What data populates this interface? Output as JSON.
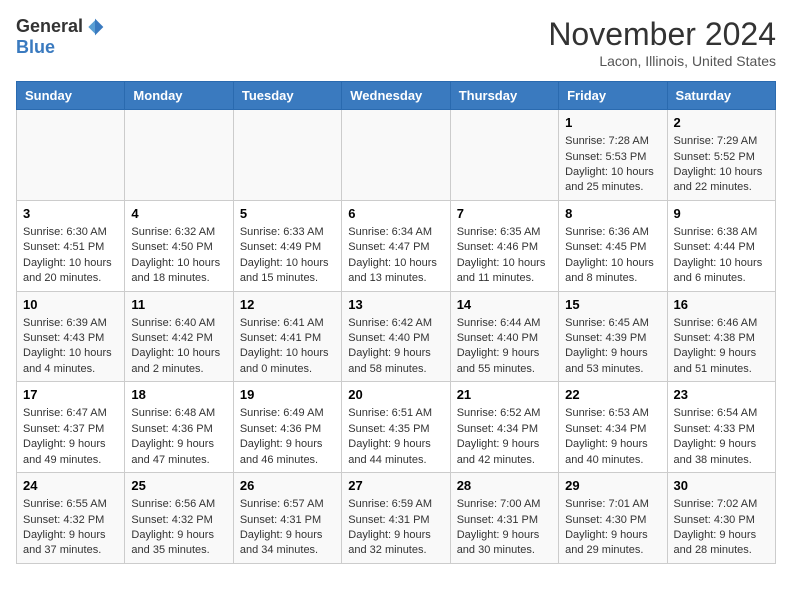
{
  "header": {
    "logo_general": "General",
    "logo_blue": "Blue",
    "month_title": "November 2024",
    "location": "Lacon, Illinois, United States"
  },
  "weekdays": [
    "Sunday",
    "Monday",
    "Tuesday",
    "Wednesday",
    "Thursday",
    "Friday",
    "Saturday"
  ],
  "weeks": [
    [
      {
        "day": "",
        "info": ""
      },
      {
        "day": "",
        "info": ""
      },
      {
        "day": "",
        "info": ""
      },
      {
        "day": "",
        "info": ""
      },
      {
        "day": "",
        "info": ""
      },
      {
        "day": "1",
        "info": "Sunrise: 7:28 AM\nSunset: 5:53 PM\nDaylight: 10 hours\nand 25 minutes."
      },
      {
        "day": "2",
        "info": "Sunrise: 7:29 AM\nSunset: 5:52 PM\nDaylight: 10 hours\nand 22 minutes."
      }
    ],
    [
      {
        "day": "3",
        "info": "Sunrise: 6:30 AM\nSunset: 4:51 PM\nDaylight: 10 hours\nand 20 minutes."
      },
      {
        "day": "4",
        "info": "Sunrise: 6:32 AM\nSunset: 4:50 PM\nDaylight: 10 hours\nand 18 minutes."
      },
      {
        "day": "5",
        "info": "Sunrise: 6:33 AM\nSunset: 4:49 PM\nDaylight: 10 hours\nand 15 minutes."
      },
      {
        "day": "6",
        "info": "Sunrise: 6:34 AM\nSunset: 4:47 PM\nDaylight: 10 hours\nand 13 minutes."
      },
      {
        "day": "7",
        "info": "Sunrise: 6:35 AM\nSunset: 4:46 PM\nDaylight: 10 hours\nand 11 minutes."
      },
      {
        "day": "8",
        "info": "Sunrise: 6:36 AM\nSunset: 4:45 PM\nDaylight: 10 hours\nand 8 minutes."
      },
      {
        "day": "9",
        "info": "Sunrise: 6:38 AM\nSunset: 4:44 PM\nDaylight: 10 hours\nand 6 minutes."
      }
    ],
    [
      {
        "day": "10",
        "info": "Sunrise: 6:39 AM\nSunset: 4:43 PM\nDaylight: 10 hours\nand 4 minutes."
      },
      {
        "day": "11",
        "info": "Sunrise: 6:40 AM\nSunset: 4:42 PM\nDaylight: 10 hours\nand 2 minutes."
      },
      {
        "day": "12",
        "info": "Sunrise: 6:41 AM\nSunset: 4:41 PM\nDaylight: 10 hours\nand 0 minutes."
      },
      {
        "day": "13",
        "info": "Sunrise: 6:42 AM\nSunset: 4:40 PM\nDaylight: 9 hours\nand 58 minutes."
      },
      {
        "day": "14",
        "info": "Sunrise: 6:44 AM\nSunset: 4:40 PM\nDaylight: 9 hours\nand 55 minutes."
      },
      {
        "day": "15",
        "info": "Sunrise: 6:45 AM\nSunset: 4:39 PM\nDaylight: 9 hours\nand 53 minutes."
      },
      {
        "day": "16",
        "info": "Sunrise: 6:46 AM\nSunset: 4:38 PM\nDaylight: 9 hours\nand 51 minutes."
      }
    ],
    [
      {
        "day": "17",
        "info": "Sunrise: 6:47 AM\nSunset: 4:37 PM\nDaylight: 9 hours\nand 49 minutes."
      },
      {
        "day": "18",
        "info": "Sunrise: 6:48 AM\nSunset: 4:36 PM\nDaylight: 9 hours\nand 47 minutes."
      },
      {
        "day": "19",
        "info": "Sunrise: 6:49 AM\nSunset: 4:36 PM\nDaylight: 9 hours\nand 46 minutes."
      },
      {
        "day": "20",
        "info": "Sunrise: 6:51 AM\nSunset: 4:35 PM\nDaylight: 9 hours\nand 44 minutes."
      },
      {
        "day": "21",
        "info": "Sunrise: 6:52 AM\nSunset: 4:34 PM\nDaylight: 9 hours\nand 42 minutes."
      },
      {
        "day": "22",
        "info": "Sunrise: 6:53 AM\nSunset: 4:34 PM\nDaylight: 9 hours\nand 40 minutes."
      },
      {
        "day": "23",
        "info": "Sunrise: 6:54 AM\nSunset: 4:33 PM\nDaylight: 9 hours\nand 38 minutes."
      }
    ],
    [
      {
        "day": "24",
        "info": "Sunrise: 6:55 AM\nSunset: 4:32 PM\nDaylight: 9 hours\nand 37 minutes."
      },
      {
        "day": "25",
        "info": "Sunrise: 6:56 AM\nSunset: 4:32 PM\nDaylight: 9 hours\nand 35 minutes."
      },
      {
        "day": "26",
        "info": "Sunrise: 6:57 AM\nSunset: 4:31 PM\nDaylight: 9 hours\nand 34 minutes."
      },
      {
        "day": "27",
        "info": "Sunrise: 6:59 AM\nSunset: 4:31 PM\nDaylight: 9 hours\nand 32 minutes."
      },
      {
        "day": "28",
        "info": "Sunrise: 7:00 AM\nSunset: 4:31 PM\nDaylight: 9 hours\nand 30 minutes."
      },
      {
        "day": "29",
        "info": "Sunrise: 7:01 AM\nSunset: 4:30 PM\nDaylight: 9 hours\nand 29 minutes."
      },
      {
        "day": "30",
        "info": "Sunrise: 7:02 AM\nSunset: 4:30 PM\nDaylight: 9 hours\nand 28 minutes."
      }
    ]
  ]
}
